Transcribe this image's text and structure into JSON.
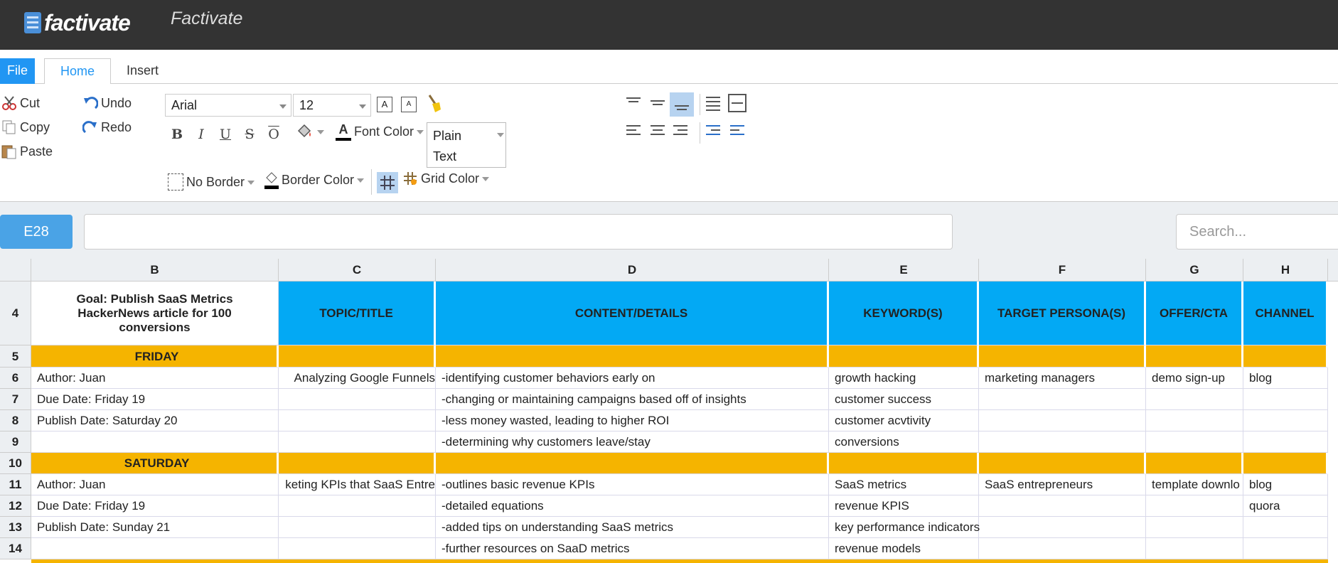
{
  "app": {
    "logo_text": "factivate",
    "title": "Factivate"
  },
  "tabs": {
    "file": "File",
    "home": "Home",
    "insert": "Insert"
  },
  "ribbon": {
    "cut": "Cut",
    "copy": "Copy",
    "paste": "Paste",
    "undo": "Undo",
    "redo": "Redo",
    "font_family": "Arial",
    "font_size": "12",
    "bold": "B",
    "italic": "I",
    "underline": "U",
    "strike": "S",
    "overline": "O",
    "font_color_glyph": "A",
    "font_color": "Font Color",
    "format_line1": "Plain",
    "format_line2": "Text",
    "no_border": "No Border",
    "border_color": "Border Color",
    "grid_color": "Grid Color"
  },
  "formula": {
    "cell_ref": "E28",
    "value": "",
    "search_placeholder": "Search..."
  },
  "grid": {
    "columns": [
      "B",
      "C",
      "D",
      "E",
      "F",
      "G",
      "H"
    ],
    "rows": [
      {
        "num": "4",
        "type": "header",
        "cells": [
          "Goal: Publish SaaS Metrics HackerNews article for 100 conversions",
          "TOPIC/TITLE",
          "CONTENT/DETAILS",
          "KEYWORD(S)",
          "TARGET   PERSONA(S)",
          "OFFER/CTA",
          "CHANNEL"
        ]
      },
      {
        "num": "5",
        "type": "day",
        "cells": [
          "FRIDAY",
          "",
          "",
          "",
          "",
          "",
          ""
        ]
      },
      {
        "num": "6",
        "type": "data",
        "cells": [
          "Author: Juan",
          "Analyzing Google Funnels",
          "-identifying customer behaviors early on",
          "growth hacking",
          "marketing managers",
          "demo sign-up",
          "blog"
        ]
      },
      {
        "num": "7",
        "type": "data",
        "cells": [
          "Due Date: Friday 19",
          "",
          "-changing or maintaining campaigns based off of insights",
          "customer success",
          "",
          "",
          ""
        ]
      },
      {
        "num": "8",
        "type": "data",
        "cells": [
          "Publish Date: Saturday 20",
          "",
          "-less money wasted, leading to higher ROI",
          "customer acvtivity",
          "",
          "",
          ""
        ]
      },
      {
        "num": "9",
        "type": "data",
        "cells": [
          "",
          "",
          "-determining why customers leave/stay",
          "conversions",
          "",
          "",
          ""
        ]
      },
      {
        "num": "10",
        "type": "day",
        "cells": [
          "SATURDAY",
          "",
          "",
          "",
          "",
          "",
          ""
        ]
      },
      {
        "num": "11",
        "type": "data",
        "cells": [
          "Author: Juan",
          "keting KPIs that SaaS Entre",
          "-outlines basic revenue KPIs",
          "SaaS metrics",
          "SaaS entrepreneurs",
          "template downlo",
          "blog"
        ]
      },
      {
        "num": "12",
        "type": "data",
        "cells": [
          "Due Date: Friday 19",
          "",
          "-detailed equations",
          "revenue KPIS",
          "",
          "",
          "quora"
        ]
      },
      {
        "num": "13",
        "type": "data",
        "cells": [
          "Publish Date: Sunday 21",
          "",
          "-added tips on understanding SaaS metrics",
          "key performance indicators",
          "",
          "",
          ""
        ]
      },
      {
        "num": "14",
        "type": "data",
        "cells": [
          "",
          "",
          "-further resources on SaaD metrics",
          "revenue models",
          "",
          "",
          ""
        ]
      }
    ]
  },
  "colors": {
    "header_blue": "#03a9f4",
    "day_orange": "#f5b400",
    "topbar": "#333333",
    "accent": "#2196f3"
  }
}
